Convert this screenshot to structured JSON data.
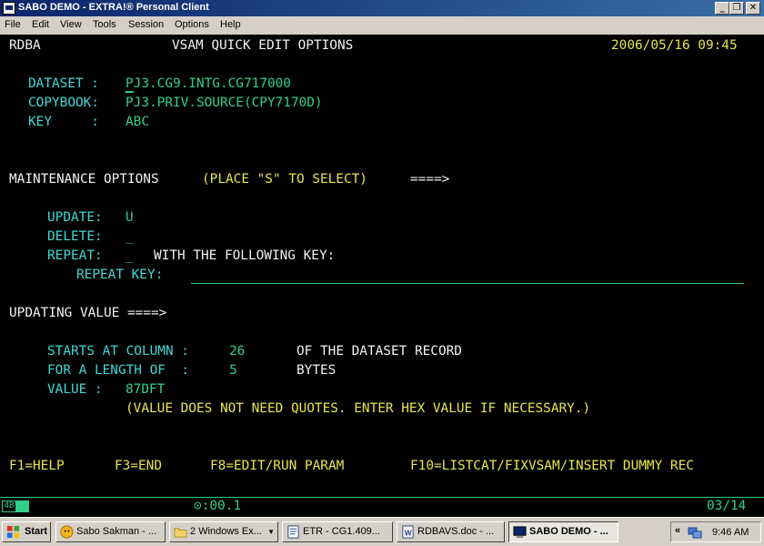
{
  "window": {
    "title": "SABO DEMO - EXTRA!® Personal Client",
    "buttons": {
      "minimize": "_",
      "restore": "❐",
      "close": "✕"
    }
  },
  "menu": [
    "File",
    "Edit",
    "View",
    "Tools",
    "Session",
    "Options",
    "Help"
  ],
  "screen": {
    "system": "RDBA",
    "heading": "VSAM QUICK EDIT OPTIONS",
    "timestamp": "2006/05/16 09:45",
    "dataset_label": "DATASET :",
    "dataset_value": "PJ3.CG9.INTG.CG717000",
    "copybook_label": "COPYBOOK:",
    "copybook_value": "PJ3.PRIV.SOURCE(CPY7170D)",
    "key_label": "KEY     :",
    "key_value": "ABC",
    "maintenance_label": "MAINTENANCE OPTIONS",
    "maintenance_hint": "(PLACE \"S\" TO SELECT)",
    "maintenance_arrow": "====>",
    "update_label": "UPDATE:",
    "update_value": "U",
    "delete_label": "DELETE:",
    "delete_value": "_",
    "repeat_label": "REPEAT:",
    "repeat_value": "_",
    "repeat_following": "WITH THE FOLLOWING KEY:",
    "repeat_key_label": "REPEAT KEY:",
    "repeat_key_value": "",
    "updating_label": "UPDATING VALUE ====>",
    "starts_label": "STARTS AT COLUMN :",
    "starts_value": "26",
    "starts_suffix": "OF THE DATASET RECORD",
    "length_label": "FOR A LENGTH OF  :",
    "length_value": "5",
    "length_suffix": "BYTES",
    "value_label": "VALUE :",
    "value_value": "87DFT",
    "value_note": "(VALUE DOES NOT NEED QUOTES. ENTER HEX VALUE IF NECESSARY.)",
    "pf_keys": [
      "F1=HELP",
      "F3=END",
      "F8=EDIT/RUN PARAM",
      "F10=LISTCAT/FIXVSAM/INSERT DUMMY REC"
    ]
  },
  "status_bar": {
    "session_indicator": "4B",
    "timer": "⊙:00.1",
    "cursor_pos": "03/14"
  },
  "taskbar": {
    "start": "Start",
    "items": [
      {
        "label": "Sabo Sakman - ...",
        "icon": "messenger-icon",
        "active": false
      },
      {
        "label": "2 Windows Ex...",
        "icon": "folder-icon",
        "active": false
      },
      {
        "label": "ETR - CG1.409...",
        "icon": "document-icon",
        "active": false
      },
      {
        "label": "RDBAVS.doc - ...",
        "icon": "word-icon",
        "active": false
      },
      {
        "label": "SABO DEMO - ...",
        "icon": "terminal-icon",
        "active": true
      }
    ],
    "tray_chevron": "«",
    "clock": "9:46 AM"
  },
  "colors": {
    "terminal_bg": "#000000",
    "green": "#2ed08a",
    "white": "#f2f2f2",
    "yellow": "#e6e64d",
    "cyan": "#40d8d8",
    "titlebar": "#0a246a"
  }
}
